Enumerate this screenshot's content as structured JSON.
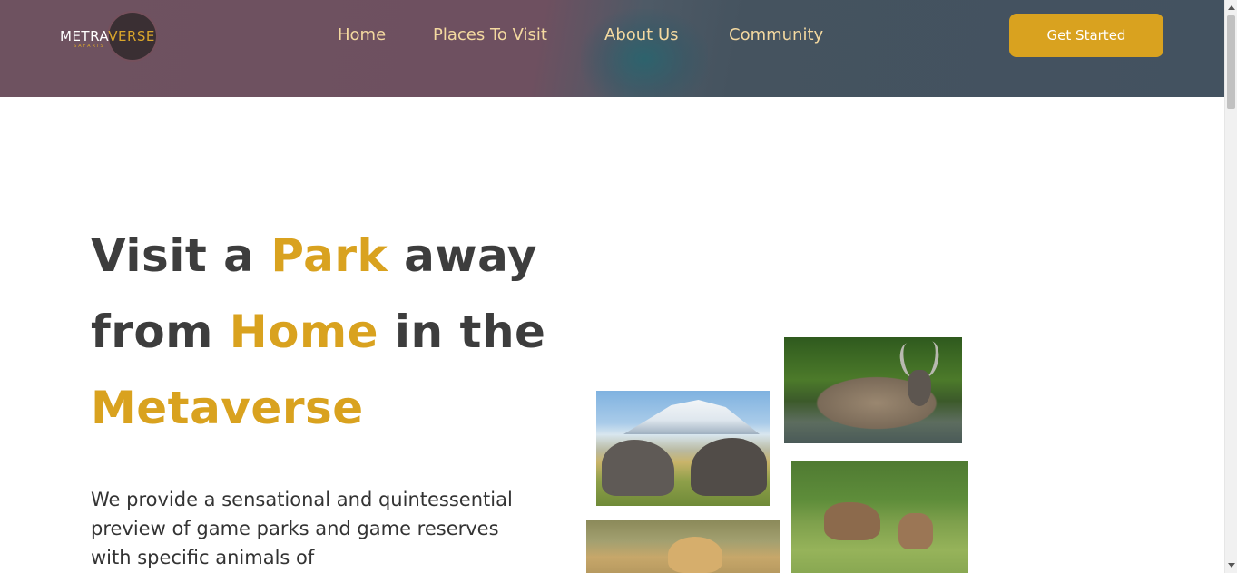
{
  "brand": {
    "name_part1": "METRA",
    "name_part2": "VERSE",
    "tagline": "SAFARIS",
    "accent_color": "#d9a21f"
  },
  "nav": {
    "items": [
      {
        "label": "Home"
      },
      {
        "label": "Places To Visit"
      },
      {
        "label": "About Us"
      },
      {
        "label": "Community"
      }
    ],
    "cta_label": "Get Started"
  },
  "hero": {
    "title_parts": {
      "t1": "Visit a ",
      "t2": "Park",
      "t3": " away",
      "t4": "from ",
      "t5": "Home",
      "t6": " in the",
      "t7": "Metaverse"
    },
    "description": "We provide a sensational and quintessential preview of game parks and game reserves with specific animals of"
  },
  "gallery": {
    "images": [
      {
        "subject": "kudu-in-water"
      },
      {
        "subject": "elephants-kilimanjaro"
      },
      {
        "subject": "eland-antelopes"
      },
      {
        "subject": "cheetah"
      }
    ]
  }
}
